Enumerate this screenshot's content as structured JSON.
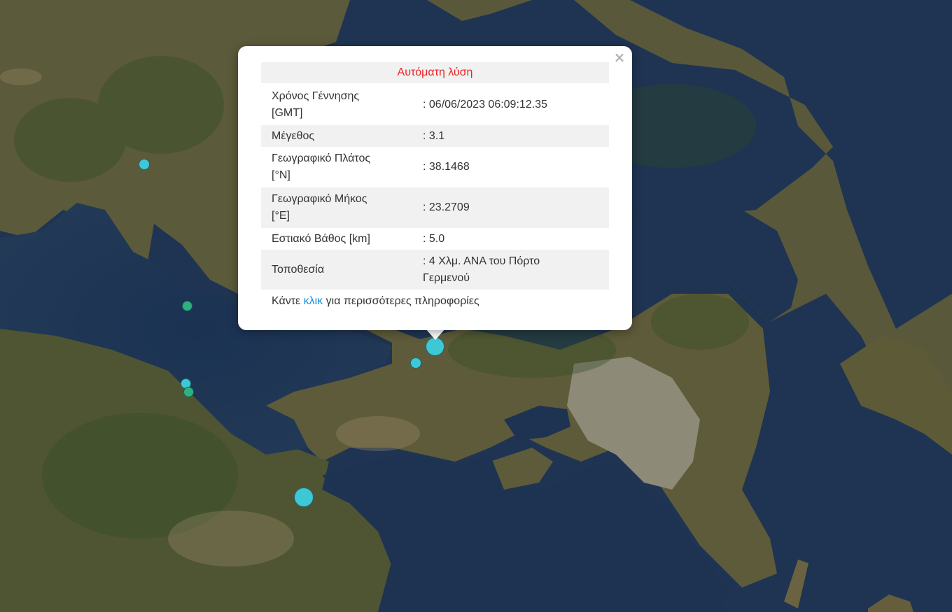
{
  "popup": {
    "close_symbol": "×",
    "title": "Αυτόματη λύση",
    "rows": [
      {
        "label_line1": "Χρόνος Γέννησης",
        "label_line2": "[GMT]",
        "value": ": 06/06/2023 06:09:12.35"
      },
      {
        "label_line1": "Μέγεθος",
        "label_line2": "",
        "value": ": 3.1"
      },
      {
        "label_line1": "Γεωγραφικό Πλάτος",
        "label_line2": "[°N]",
        "value": ": 38.1468"
      },
      {
        "label_line1": "Γεωγραφικό Μήκος",
        "label_line2": "[°E]",
        "value": ": 23.2709"
      },
      {
        "label_line1": "Εστιακό Βάθος [km]",
        "label_line2": "",
        "value": ": 5.0"
      },
      {
        "label_line1": "Τοποθεσία",
        "label_line2": "",
        "value_line1": ": 4 Χλμ. ΑΝΑ του Πόρτο",
        "value_line2": "Γερμενού"
      }
    ],
    "footer": {
      "before": "Κάντε ",
      "link": "κλικ",
      "after": " για περισσότερες πληροφορίες"
    }
  },
  "map": {
    "marker_colors": {
      "recent": "#3ec8d6",
      "older": "#2bb27e"
    },
    "sea_color": "#1d3350",
    "land_color": "#5f5a36"
  }
}
